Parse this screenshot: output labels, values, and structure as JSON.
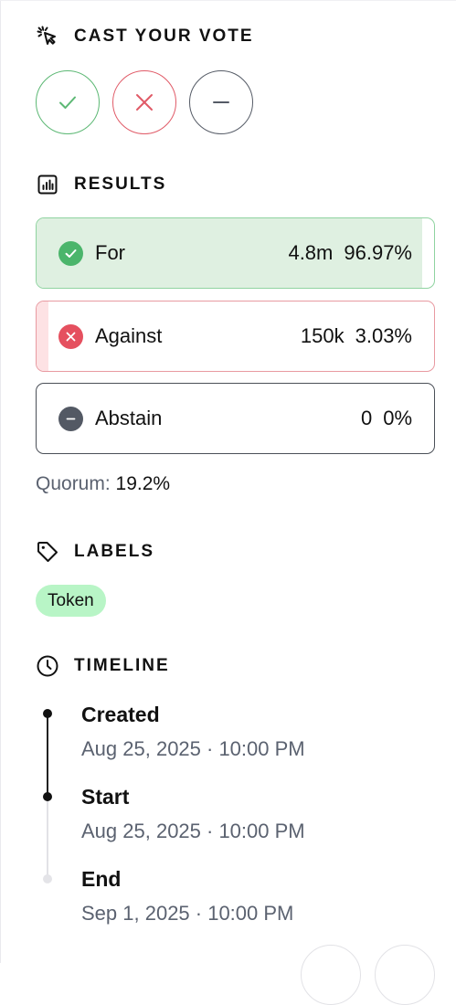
{
  "cast_vote": {
    "title": "CAST YOUR VOTE",
    "icon": "cursor-click-icon",
    "buttons": [
      {
        "name": "vote-for-button",
        "icon": "check-icon",
        "color": "#5cb874"
      },
      {
        "name": "vote-against-button",
        "icon": "x-icon",
        "color": "#e05a67"
      },
      {
        "name": "vote-abstain-button",
        "icon": "minus-icon",
        "color": "#555b66"
      }
    ]
  },
  "results": {
    "title": "RESULTS",
    "icon": "bar-chart-icon",
    "items": [
      {
        "label": "For",
        "amount": "4.8m",
        "percent": "96.97%",
        "share": 0.9697,
        "color": "#4bb56b",
        "fill": "#dff0e1"
      },
      {
        "label": "Against",
        "amount": "150k",
        "percent": "3.03%",
        "share": 0.0303,
        "color": "#e5505f",
        "fill": "#fde2e4"
      },
      {
        "label": "Abstain",
        "amount": "0",
        "percent": "0%",
        "share": 0,
        "color": "#535964",
        "fill": "#eeeeee"
      }
    ],
    "quorum_label": "Quorum:",
    "quorum_value": "19.2%"
  },
  "labels": {
    "title": "LABELS",
    "icon": "tag-icon",
    "tags": [
      "Token"
    ]
  },
  "timeline": {
    "title": "TIMELINE",
    "icon": "clock-icon",
    "events": [
      {
        "title": "Created",
        "time": "Aug 25, 2025 · 10:00 PM",
        "status": "complete"
      },
      {
        "title": "Start",
        "time": "Aug 25, 2025 · 10:00 PM",
        "status": "complete"
      },
      {
        "title": "End",
        "time": "Sep 1, 2025 · 10:00 PM",
        "status": "upcoming"
      }
    ]
  }
}
